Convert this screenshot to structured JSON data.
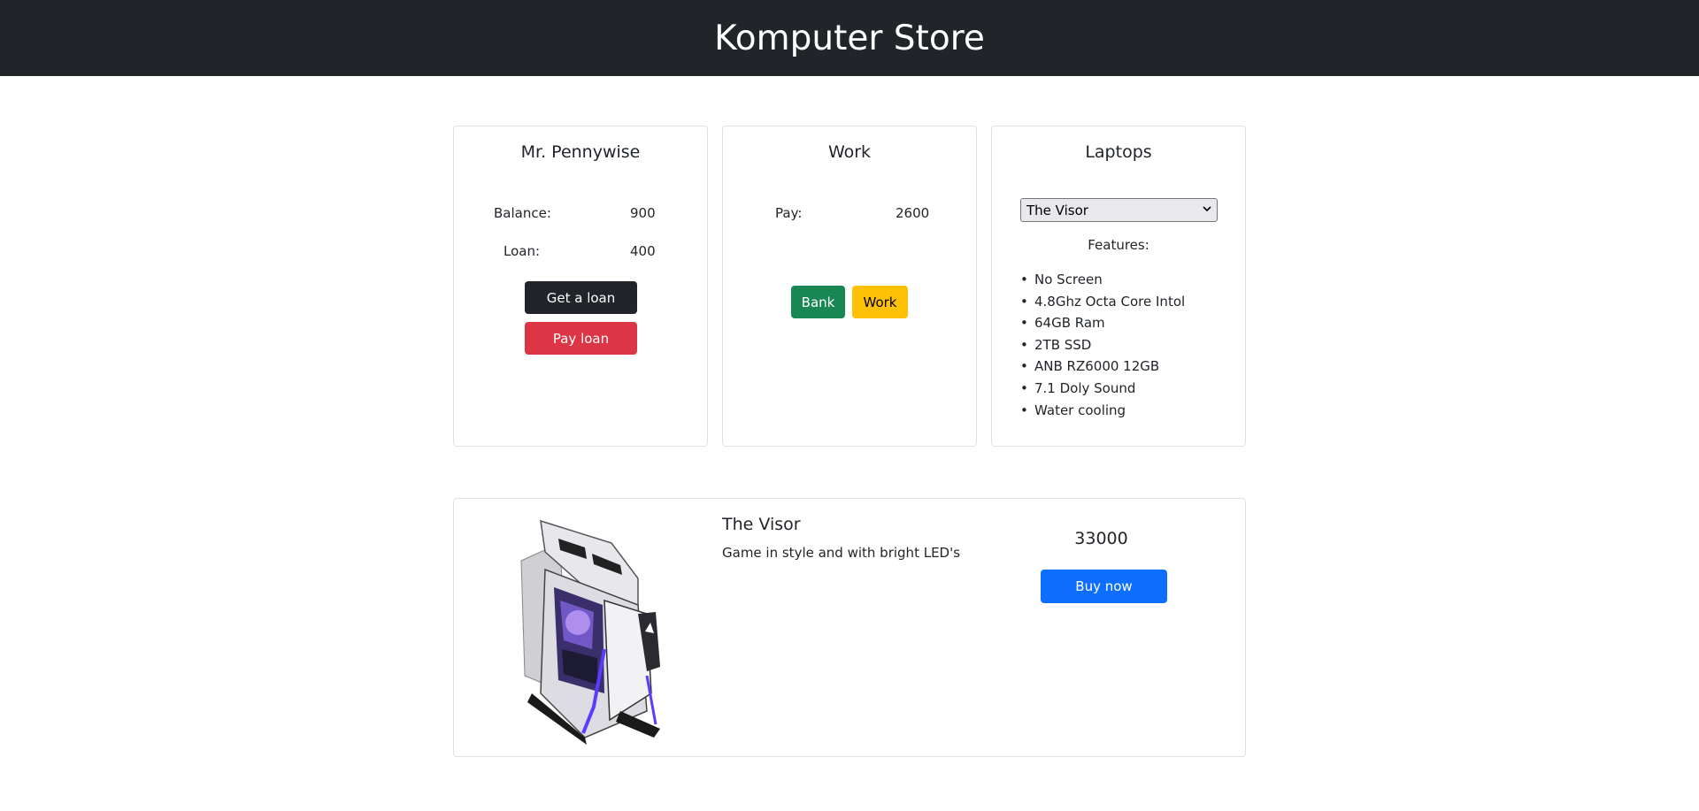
{
  "header": {
    "title": "Komputer Store"
  },
  "bank": {
    "title": "Mr. Pennywise",
    "balance_label": "Balance:",
    "balance_value": "900",
    "loan_label": "Loan:",
    "loan_value": "400",
    "get_loan_label": "Get a loan",
    "pay_loan_label": "Pay loan"
  },
  "work": {
    "title": "Work",
    "pay_label": "Pay:",
    "pay_value": "2600",
    "bank_button_label": "Bank",
    "work_button_label": "Work"
  },
  "laptops": {
    "title": "Laptops",
    "selected": "The Visor",
    "features_label": "Features:",
    "features": [
      "No Screen",
      "4.8Ghz Octa Core Intol",
      "64GB Ram",
      "2TB SSD",
      "ANB RZ6000 12GB",
      "7.1 Doly Sound",
      "Water cooling"
    ]
  },
  "product": {
    "name": "The Visor",
    "description": "Game in style and with bright LED's",
    "price": "33000",
    "buy_label": "Buy now",
    "image_icon": "pc-case-icon"
  },
  "colors": {
    "navbar": "#212529",
    "get_loan": "#212529",
    "pay_loan": "#dc3545",
    "bank": "#198754",
    "work": "#ffc107",
    "buy": "#0d6efd"
  }
}
